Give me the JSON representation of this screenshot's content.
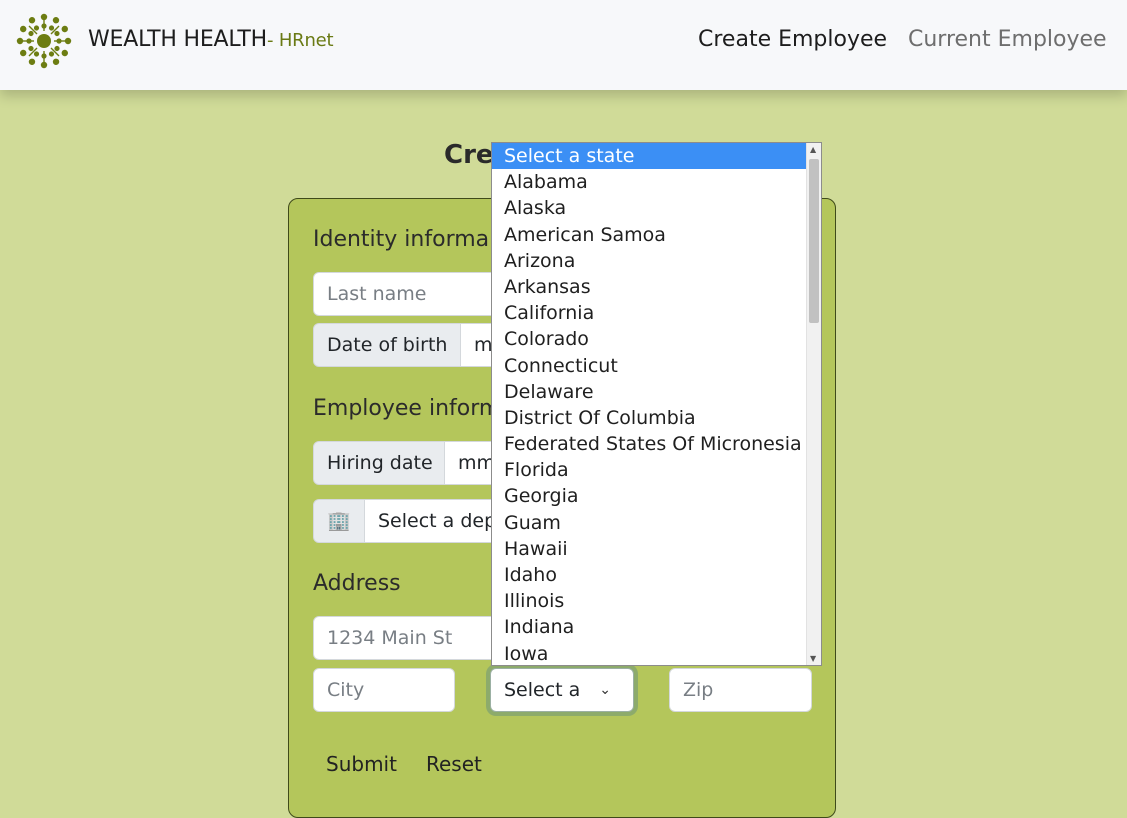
{
  "navbar": {
    "brand": "WEALTH HEALTH",
    "brand_sub": "- HRnet",
    "links": {
      "create": "Create Employee",
      "current": "Current Employee"
    }
  },
  "page": {
    "title": "Cre"
  },
  "form": {
    "identity_title": "Identity informa",
    "last_name_placeholder": "Last name",
    "dob_label": "Date of birth",
    "dob_value": "m",
    "employee_title": "Employee inform",
    "hiring_label": "Hiring date",
    "hiring_value": "mm",
    "department_icon": "🏢",
    "department_value": "Select a dep",
    "address_title": "Address",
    "street_placeholder": "1234 Main St",
    "city_placeholder": "City",
    "state_value": "Select a",
    "zip_placeholder": "Zip",
    "submit_label": "Submit",
    "reset_label": "Reset"
  },
  "state_dropdown": {
    "options": [
      "Select a state",
      "Alabama",
      "Alaska",
      "American Samoa",
      "Arizona",
      "Arkansas",
      "California",
      "Colorado",
      "Connecticut",
      "Delaware",
      "District Of Columbia",
      "Federated States Of Micronesia",
      "Florida",
      "Georgia",
      "Guam",
      "Hawaii",
      "Idaho",
      "Illinois",
      "Indiana",
      "Iowa"
    ],
    "selected_index": 0
  },
  "colors": {
    "page_bg": "#d0db98",
    "card_bg": "#b4c65b",
    "brand_accent": "#6a7a14",
    "highlight": "#3b8ff5"
  }
}
